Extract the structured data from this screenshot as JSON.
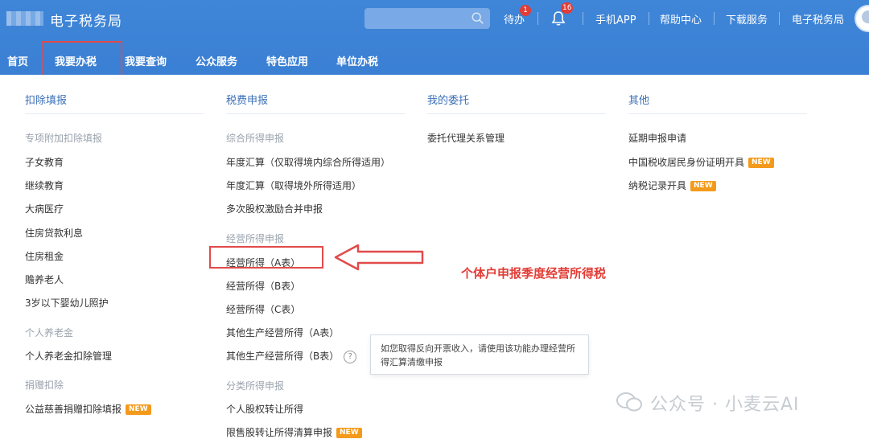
{
  "header": {
    "site_title": "电子税务局",
    "search_placeholder": "",
    "todo_label": "待办",
    "todo_count": "1",
    "notify_count": "16",
    "links": [
      "手机APP",
      "帮助中心",
      "下载服务",
      "电子税务局"
    ]
  },
  "nav": [
    "首页",
    "我要办税",
    "我要查询",
    "公众服务",
    "特色应用",
    "单位办税"
  ],
  "columns": {
    "deduction": {
      "title": "扣除填报",
      "groups": [
        {
          "sub": "专项附加扣除填报",
          "items": [
            "子女教育",
            "继续教育",
            "大病医疗",
            "住房贷款利息",
            "住房租金",
            "赡养老人",
            "3岁以下婴幼儿照护"
          ]
        },
        {
          "sub": "个人养老金",
          "items": [
            "个人养老金扣除管理"
          ]
        },
        {
          "sub": "捐赠扣除",
          "items": [
            "公益慈善捐赠扣除填报"
          ]
        }
      ]
    },
    "tax": {
      "title": "税费申报",
      "groups": [
        {
          "sub": "综合所得申报",
          "items": [
            "年度汇算（仅取得境内综合所得适用）",
            "年度汇算（取得境外所得适用）",
            "多次股权激励合并申报"
          ]
        },
        {
          "sub": "经营所得申报",
          "items": [
            "经营所得（A表）",
            "经营所得（B表）",
            "经营所得（C表）",
            "其他生产经营所得（A表）",
            "其他生产经营所得（B表）"
          ]
        },
        {
          "sub": "分类所得申报",
          "items": [
            "个人股权转让所得",
            "限售股转让所得清算申报"
          ]
        }
      ]
    },
    "entrust": {
      "title": "我的委托",
      "items": [
        "委托代理关系管理"
      ]
    },
    "other": {
      "title": "其他",
      "items": [
        "延期申报申请",
        "中国税收居民身份证明开具",
        "纳税记录开具"
      ]
    }
  },
  "new_badge": "NEW",
  "help_glyph": "?",
  "tooltip": "如您取得反向开票收入，请使用该功能办理经营所得汇算清缴申报",
  "annotation": "个体户申报季度经营所得税",
  "watermark": "公众号 · 小麦云AI",
  "colors": {
    "header": "#3a7fd3",
    "accent": "#3a6fb7",
    "highlight": "#e24a4a",
    "badge": "#f39a1b"
  }
}
